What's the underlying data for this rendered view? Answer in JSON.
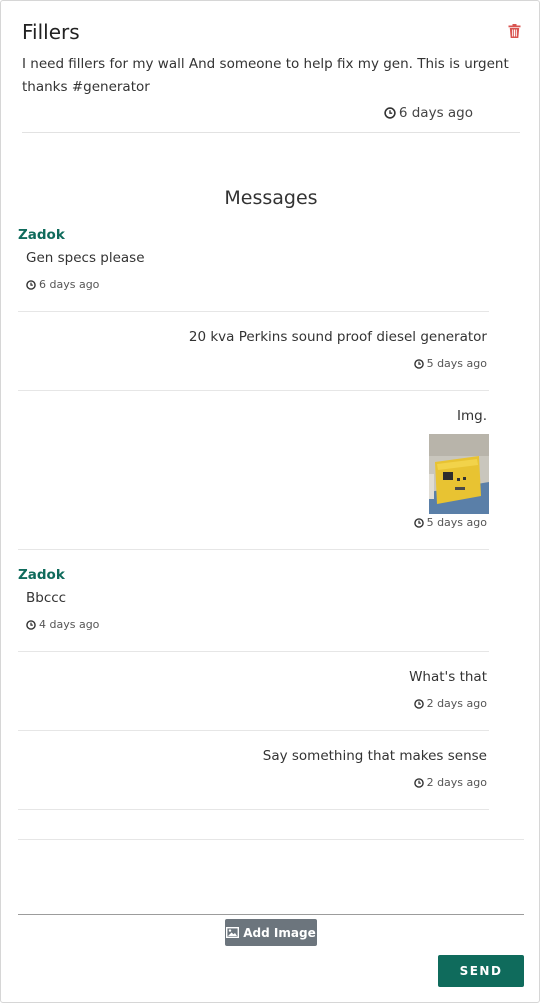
{
  "post": {
    "title": "Fillers",
    "body": "I need fillers for my wall And someone to help fix my gen. This is urgent thanks #generator",
    "time": "6 days ago"
  },
  "messages_heading": "Messages",
  "messages": [
    {
      "side": "left",
      "sender": "Zadok",
      "text": "Gen specs please",
      "time": "6 days ago"
    },
    {
      "side": "right",
      "text": "20 kva Perkins sound proof diesel generator",
      "time": "5 days ago"
    },
    {
      "side": "right",
      "text": "Img.",
      "time": "5 days ago",
      "has_image": true
    },
    {
      "side": "left",
      "sender": "Zadok",
      "text": "Bbccc",
      "time": "4 days ago"
    },
    {
      "side": "right",
      "text": "What's that",
      "time": "2 days ago"
    },
    {
      "side": "right",
      "text": "Say something that makes sense",
      "time": "2 days ago"
    }
  ],
  "composer": {
    "placeholder": "",
    "add_image_label": "Add Image",
    "send_label": "SEND"
  },
  "colors": {
    "accent": "#0f6b5c",
    "delete": "#d9534f",
    "secondary_button": "#6c757d"
  },
  "icons": {
    "delete": "trash-icon",
    "time": "clock-icon",
    "image": "image-icon"
  }
}
